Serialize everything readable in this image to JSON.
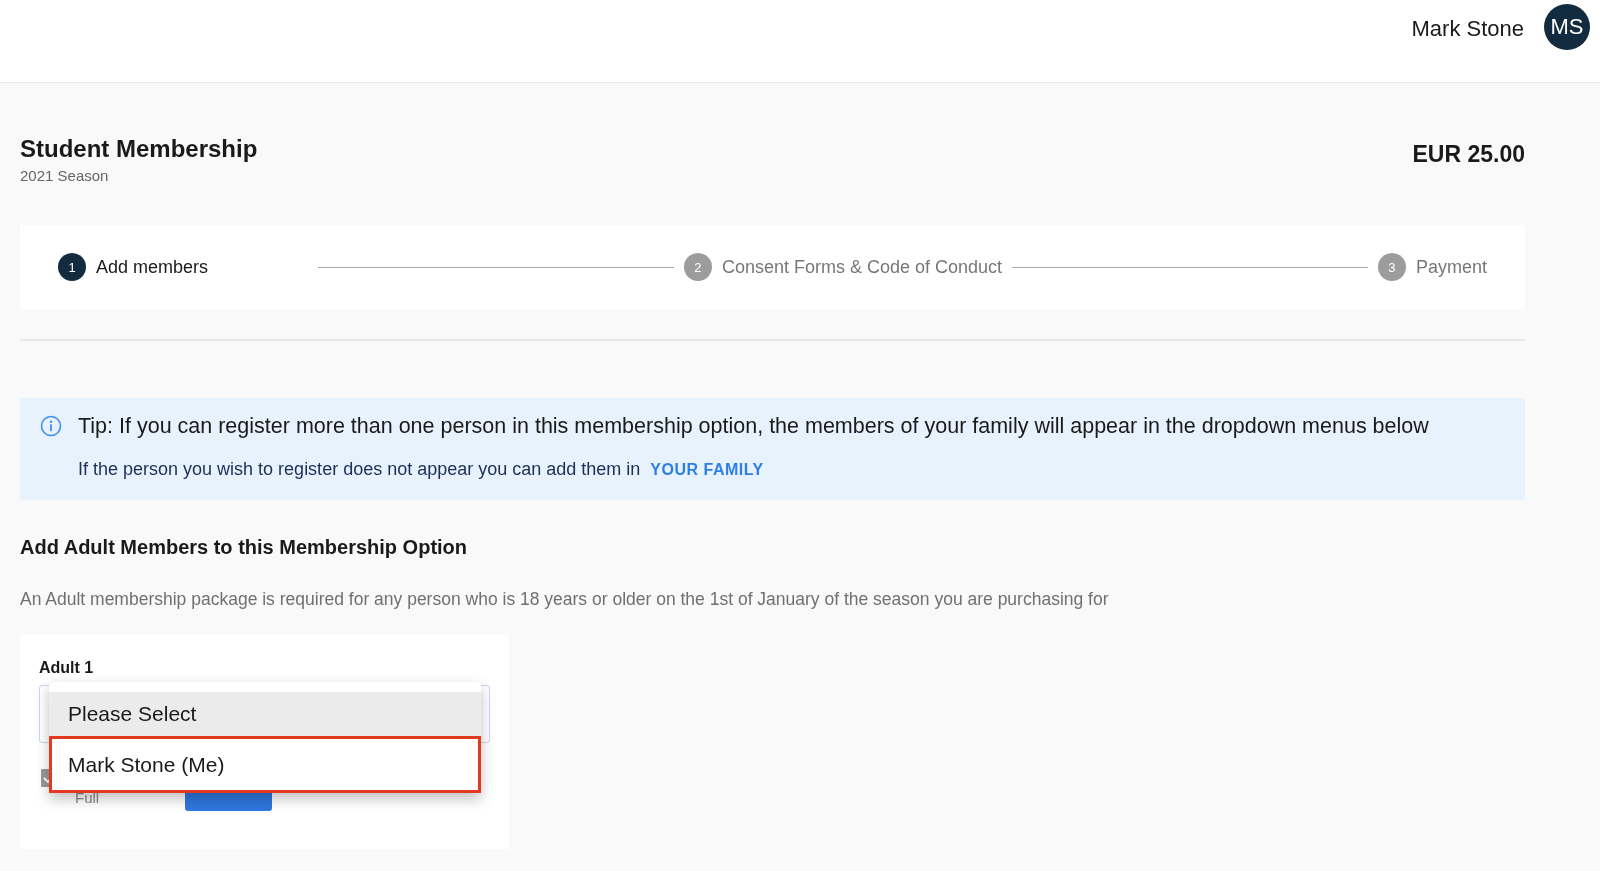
{
  "header": {
    "user_name": "Mark Stone",
    "avatar_initials": "MS"
  },
  "membership": {
    "title": "Student Membership",
    "season": "2021 Season",
    "price": "EUR 25.00"
  },
  "steps": [
    {
      "number": "1",
      "label": "Add members",
      "selected": true
    },
    {
      "number": "2",
      "label": "Consent Forms & Code of Conduct",
      "selected": false
    },
    {
      "number": "3",
      "label": "Payment",
      "selected": false
    }
  ],
  "tip": {
    "text": "Tip: If you can register more than one person in this membership option, the members of your family will appear in the dropdown menus below",
    "note": "If the person you wish to register does not appear you can add them in",
    "link": "YOUR FAMILY"
  },
  "section": {
    "title": "Add Adult Members to this Membership Option",
    "description": "An Adult membership package is required for any person who is 18 years or older on the 1st of January of the season you are purchasing for"
  },
  "adult_card": {
    "label": "Adult 1",
    "checkbox_label": "Full",
    "checkbox_checked": true,
    "dropdown": {
      "options": [
        {
          "label": "Please Select",
          "selected": true,
          "outlined": false
        },
        {
          "label": "Mark Stone (Me)",
          "selected": false,
          "outlined": true
        }
      ]
    }
  }
}
